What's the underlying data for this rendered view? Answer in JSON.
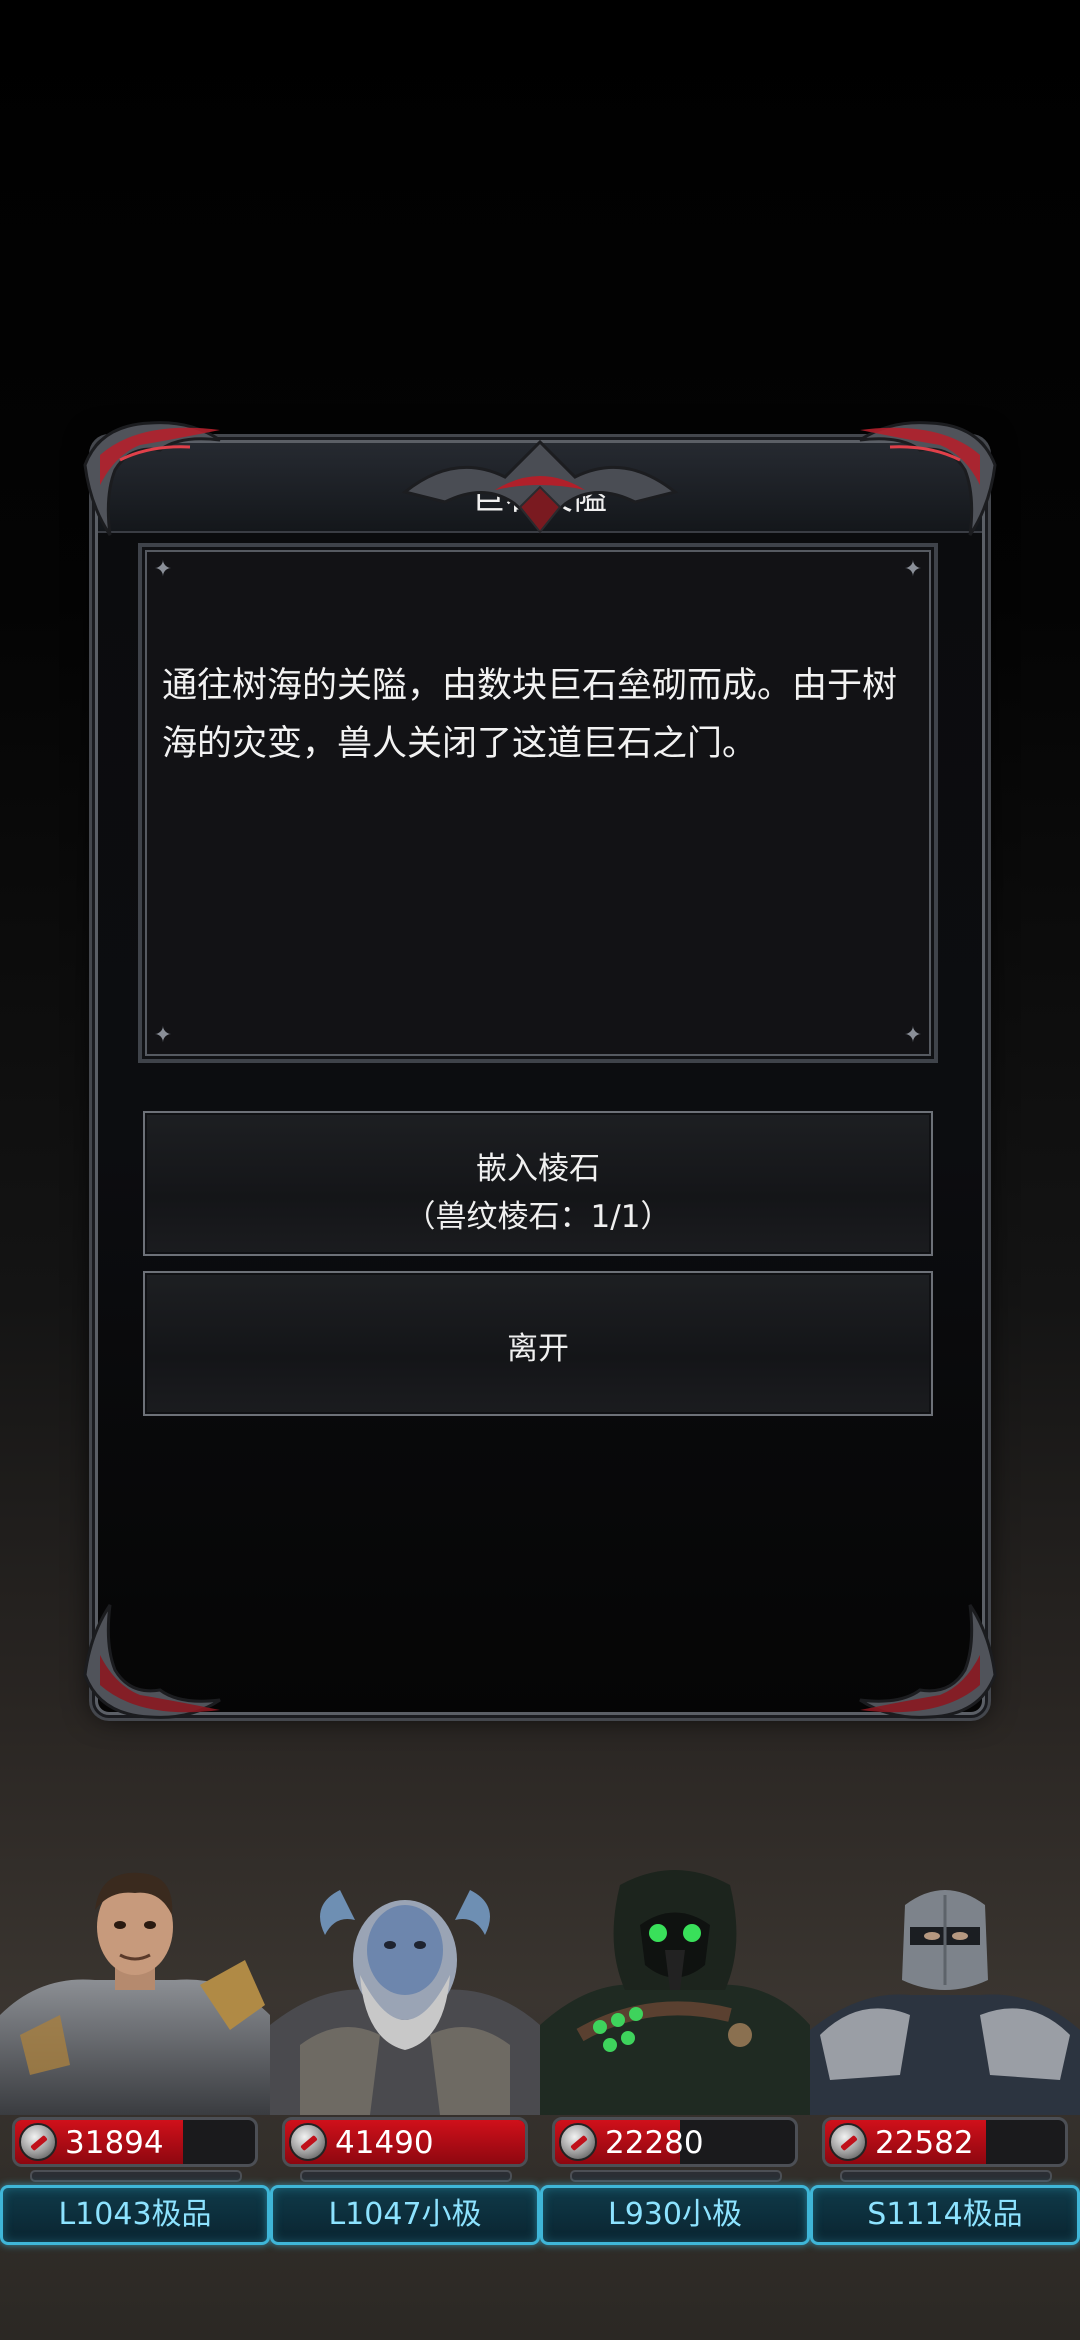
{
  "dialog": {
    "title": "巨石关隘",
    "description": "通往树海的关隘，由数块巨石垒砌而成。由于树海的灾变，兽人关闭了这道巨石之门。",
    "options": [
      {
        "label": "嵌入棱石",
        "detail": "（兽纹棱石：1/1）"
      },
      {
        "label": "离开"
      }
    ]
  },
  "party": [
    {
      "hp": "31894",
      "hp_fill_percent": 70,
      "name": "L1043极品",
      "portrait_icon": "warrior-portrait"
    },
    {
      "hp": "41490",
      "hp_fill_percent": 100,
      "name": "L1047小极",
      "portrait_icon": "horned-beast-portrait"
    },
    {
      "hp": "22280",
      "hp_fill_percent": 52,
      "name": "L930小极",
      "portrait_icon": "plague-doctor-portrait"
    },
    {
      "hp": "22582",
      "hp_fill_percent": 67,
      "name": "S1114极品",
      "portrait_icon": "masked-knight-portrait"
    }
  ],
  "colors": {
    "hp_red": "#c0111b",
    "name_plate_border": "#3fb6d8",
    "name_text": "#8de3ff"
  }
}
